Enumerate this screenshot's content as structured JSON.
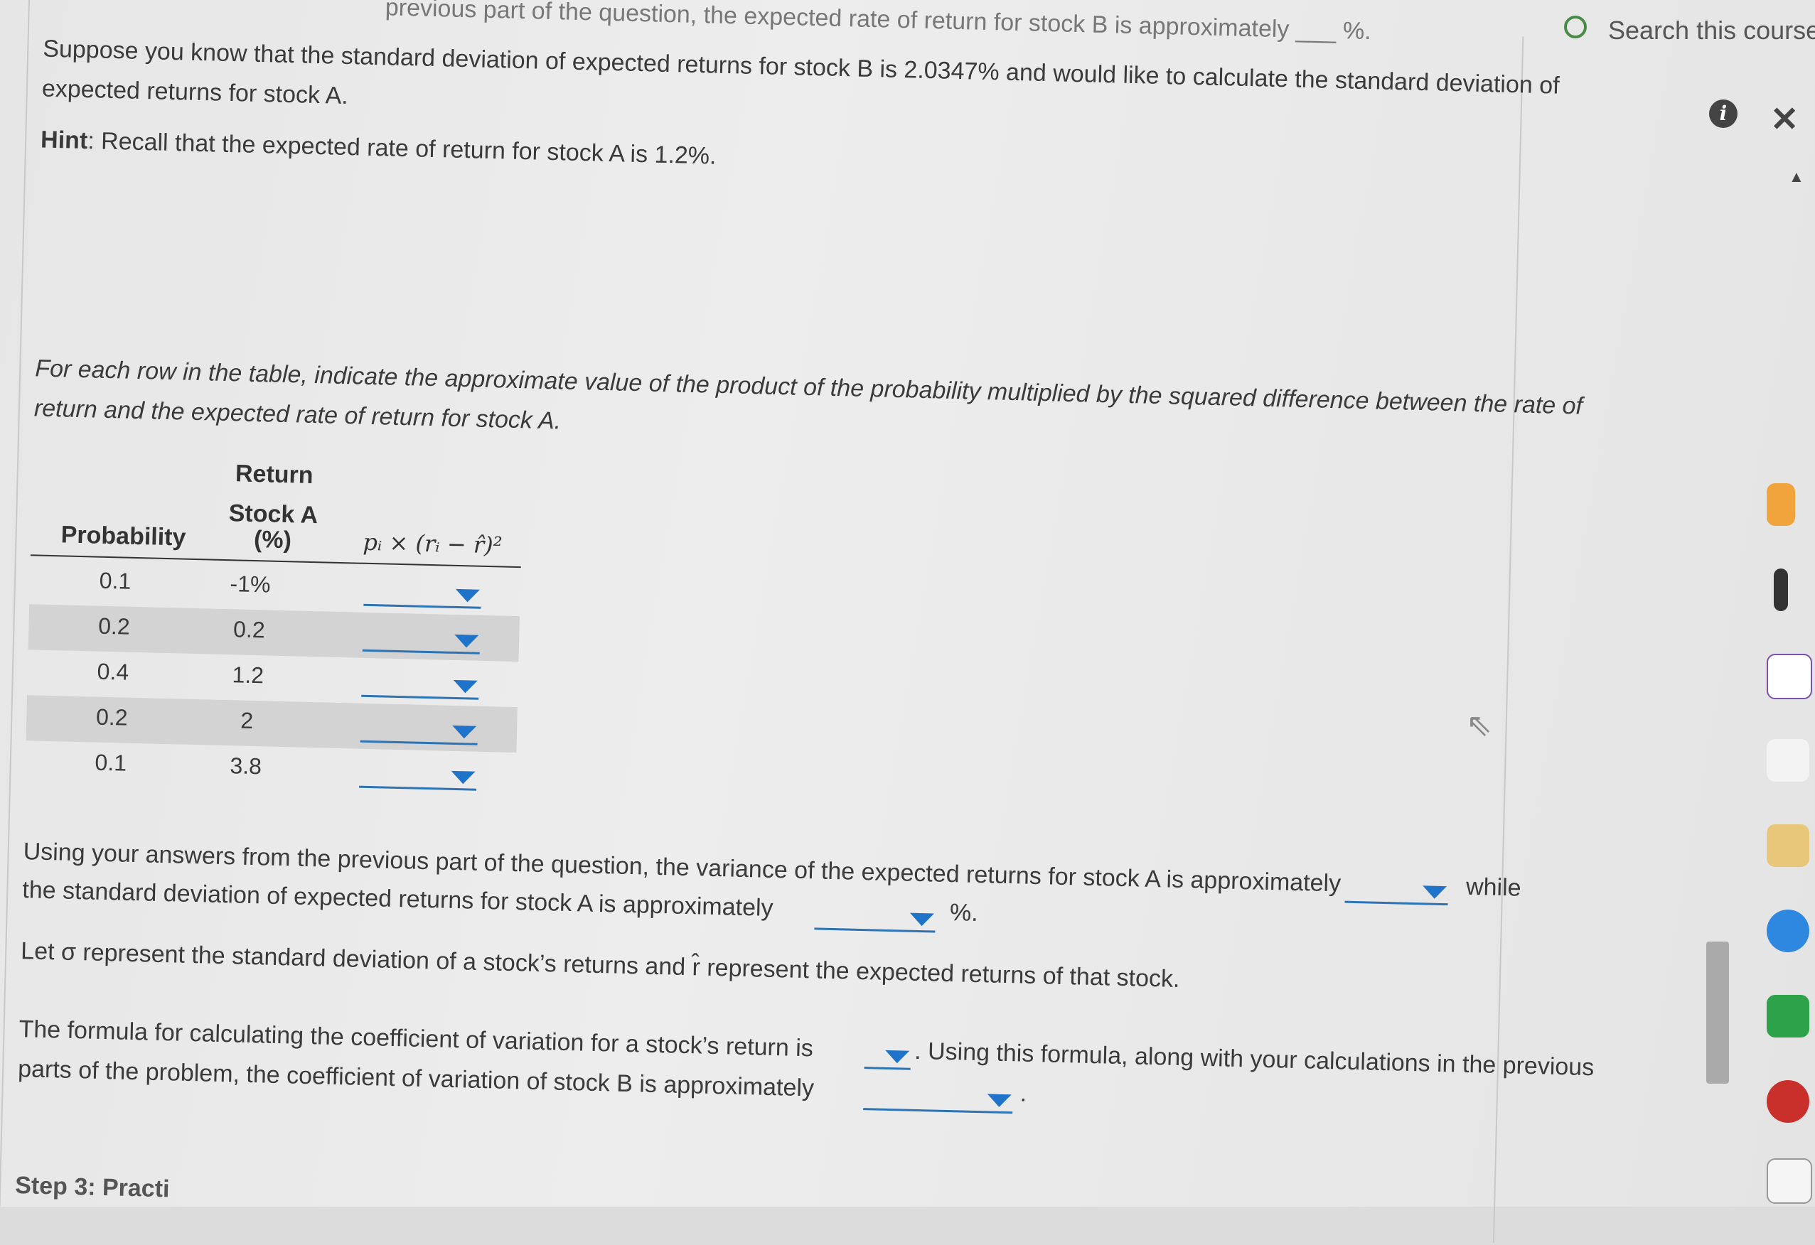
{
  "header": {
    "cut_text": "previous part of the question, the expected rate of return for stock B is approximately ___ %.",
    "search_label": "Search this course"
  },
  "intro": {
    "line1": "Suppose you know that the standard deviation of expected returns for stock B is 2.0347% and would like to calculate the standard deviation of",
    "line2": "expected returns for stock A.",
    "hint_label": "Hint",
    "hint_text": ": Recall that the expected rate of return for stock A is 1.2%."
  },
  "instructions": {
    "line1": "For each row in the table, indicate the approximate value of the product of the probability multiplied by the squared difference between the rate of",
    "line2": "return and the expected rate of return for stock A."
  },
  "table": {
    "header_return": "Return",
    "header_stock": "Stock A",
    "header_prob": "Probability",
    "header_pct": "(%)",
    "header_formula": "pᵢ × (rᵢ − r̂)²",
    "rows": [
      {
        "prob": "0.1",
        "ret": "-1%"
      },
      {
        "prob": "0.2",
        "ret": "0.2"
      },
      {
        "prob": "0.4",
        "ret": "1.2"
      },
      {
        "prob": "0.2",
        "ret": "2"
      },
      {
        "prob": "0.1",
        "ret": "3.8"
      }
    ]
  },
  "variance": {
    "line1": "Using your answers from the previous part of the question, the variance of the expected returns for stock A is approximately",
    "while": "while",
    "line2": "the standard deviation of expected returns for stock A is approximately",
    "pct": "%."
  },
  "sigma": {
    "text": "Let σ represent the standard deviation of a stock’s returns and r̂ represent the expected returns of that stock."
  },
  "cv": {
    "line1a": "The formula for calculating the coefficient of variation for a stock’s return is",
    "line1b": ". Using this formula, along with your calculations in the previous",
    "line2": "parts of the problem, the coefficient of variation of stock B is approximately",
    "end": "."
  },
  "footer": {
    "step": "Step 3: Practi"
  },
  "colors": {
    "dropdown": "#1f73c9",
    "search_icon": "#4a8b4a"
  }
}
